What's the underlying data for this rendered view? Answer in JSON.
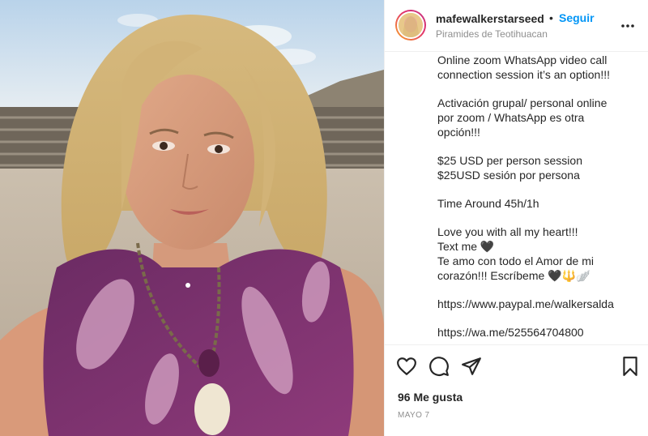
{
  "post": {
    "username": "mafewalkerstarseed",
    "separator": "•",
    "follow_label": "Seguir",
    "location": "Piramides de Teotihuacan",
    "caption_lines": [
      "Online zoom WhatsApp video call",
      "connection session it’s an option!!!",
      "",
      "Activación grupal/ personal online",
      "por zoom / WhatsApp es otra",
      "opción!!!",
      "",
      "$25 USD per person session",
      "$25USD sesión por persona",
      "",
      "Time Around 45h/1h",
      "",
      "Love you with all my heart!!!",
      "Text me 🖤",
      "Te amo con todo el Amor de mi",
      "corazón!!! Escríbeme 🖤🔱🪽",
      "",
      "https://www.paypal.me/walkersalda",
      "",
      "https://wa.me/525564704800"
    ],
    "likes": "96 Me gusta",
    "date": "MAYO 7"
  },
  "icons": {
    "more": "more-options-icon",
    "like": "heart-icon",
    "comment": "comment-icon",
    "share": "paper-plane-icon",
    "save": "bookmark-icon"
  },
  "colors": {
    "follow": "#0095f6",
    "text": "#262626",
    "muted": "#8e8e8e",
    "border": "#efefef"
  }
}
